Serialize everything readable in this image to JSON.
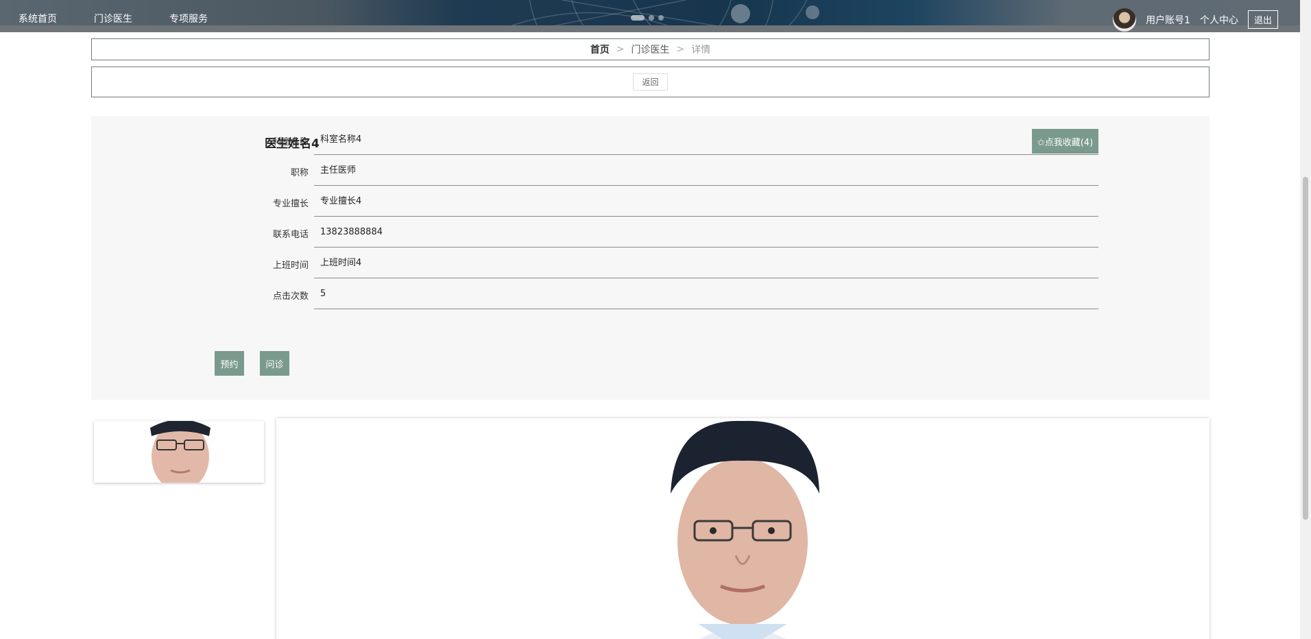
{
  "nav": {
    "items": [
      {
        "label": "系统首页"
      },
      {
        "label": "门诊医生"
      },
      {
        "label": "专项服务"
      }
    ]
  },
  "user": {
    "account": "用户账号1",
    "center": "个人中心",
    "logout": "退出"
  },
  "breadcrumb": {
    "home": "首页",
    "sep": ">",
    "parent": "门诊医生",
    "current": "详情"
  },
  "back": {
    "label": "返回"
  },
  "doctor": {
    "name": "医生姓名4",
    "favorite_label": "✩点我收藏(4)",
    "fields": [
      {
        "label": "科室名称",
        "value": "科室名称4"
      },
      {
        "label": "职称",
        "value": "主任医师"
      },
      {
        "label": "专业擅长",
        "value": "专业擅长4"
      },
      {
        "label": "联系电话",
        "value": "13823888884"
      },
      {
        "label": "上班时间",
        "value": "上班时间4"
      },
      {
        "label": "点击次数",
        "value": "5"
      }
    ],
    "actions": {
      "book": "预约",
      "consult": "问诊"
    }
  },
  "colors": {
    "accent": "#7a9a8d",
    "border": "#6f7c75"
  }
}
